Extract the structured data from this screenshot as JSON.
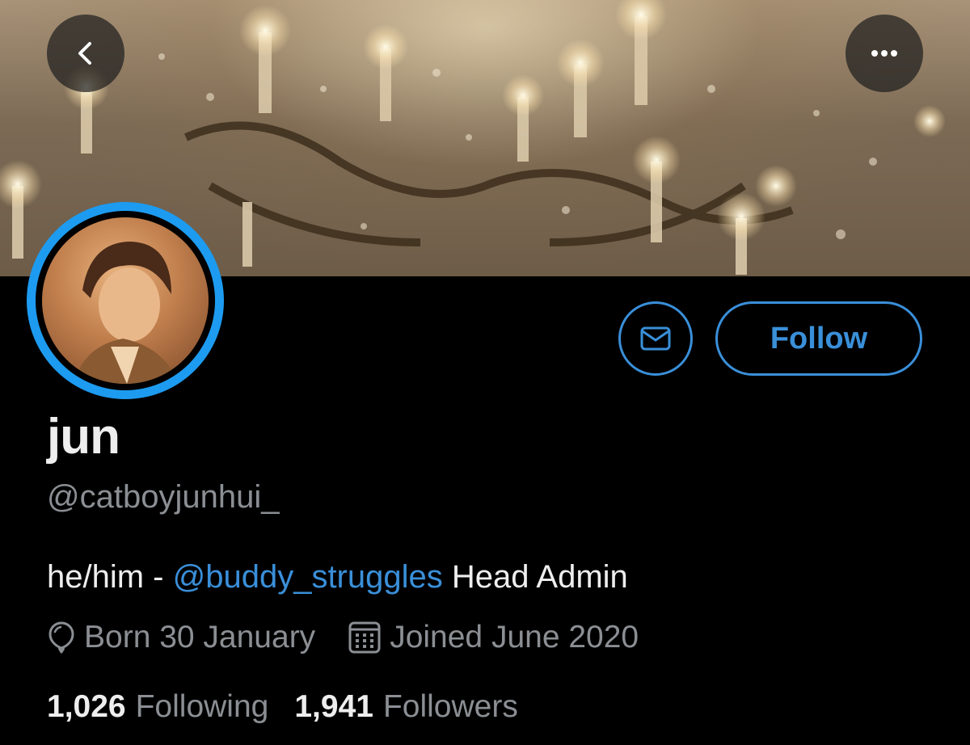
{
  "profile": {
    "display_name": "jun",
    "handle": "@catboyjunhui_",
    "bio_prefix": "he/him - ",
    "bio_mention": "@buddy_struggles",
    "bio_suffix": " Head Admin",
    "birthday": "Born 30 January",
    "joined": "Joined June 2020"
  },
  "stats": {
    "following_count": "1,026",
    "following_label": "Following",
    "followers_count": "1,941",
    "followers_label": "Followers"
  },
  "actions": {
    "follow_label": "Follow"
  },
  "icons": {
    "back": "chevron-left-icon",
    "more": "more-horizontal-icon",
    "message": "envelope-icon",
    "birthday": "balloon-icon",
    "joined": "calendar-icon"
  },
  "colors": {
    "accent": "#3a8fd9",
    "avatar_ring": "#1d9bf0",
    "secondary_text": "#8b8f94",
    "primary_text": "#eeeeee",
    "background": "#000000"
  }
}
